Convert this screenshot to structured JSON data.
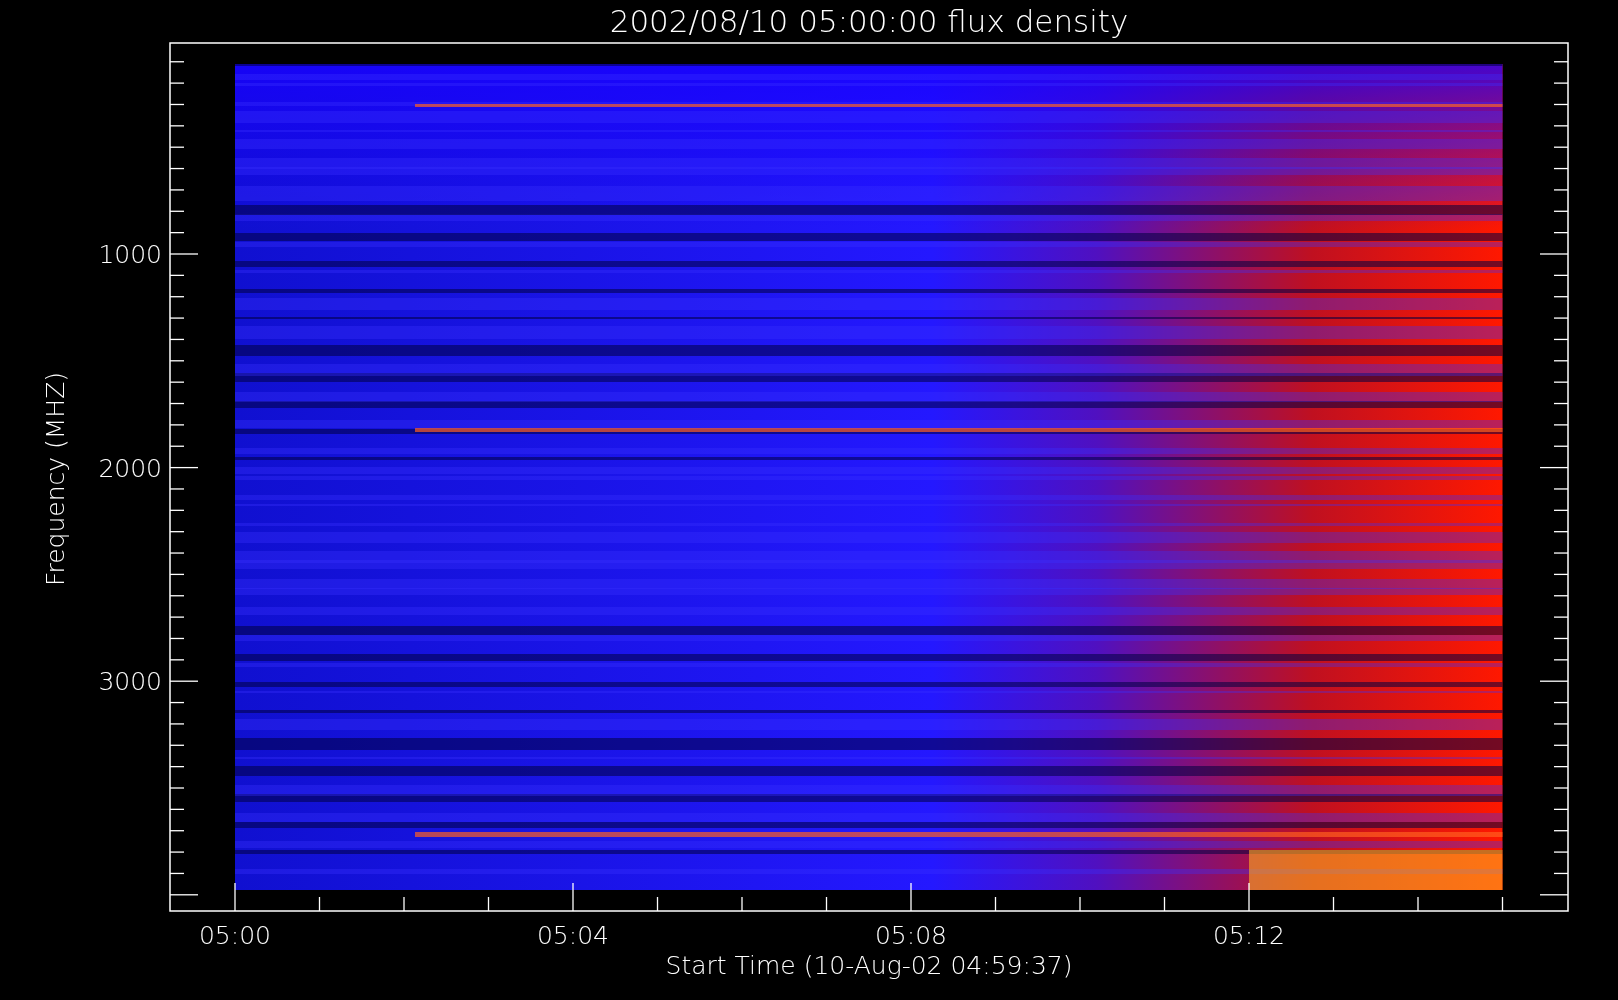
{
  "plot": {
    "title": "2002/08/10 05:00:00 flux density",
    "ylabel": "Frequency (MHZ)",
    "xlabel": "Start Time (10-Aug-02 04:59:37)",
    "yticks": [
      "1000",
      "2000",
      "3000"
    ],
    "xticks": [
      "05:00",
      "05:04",
      "05:08",
      "05:12"
    ]
  }
}
